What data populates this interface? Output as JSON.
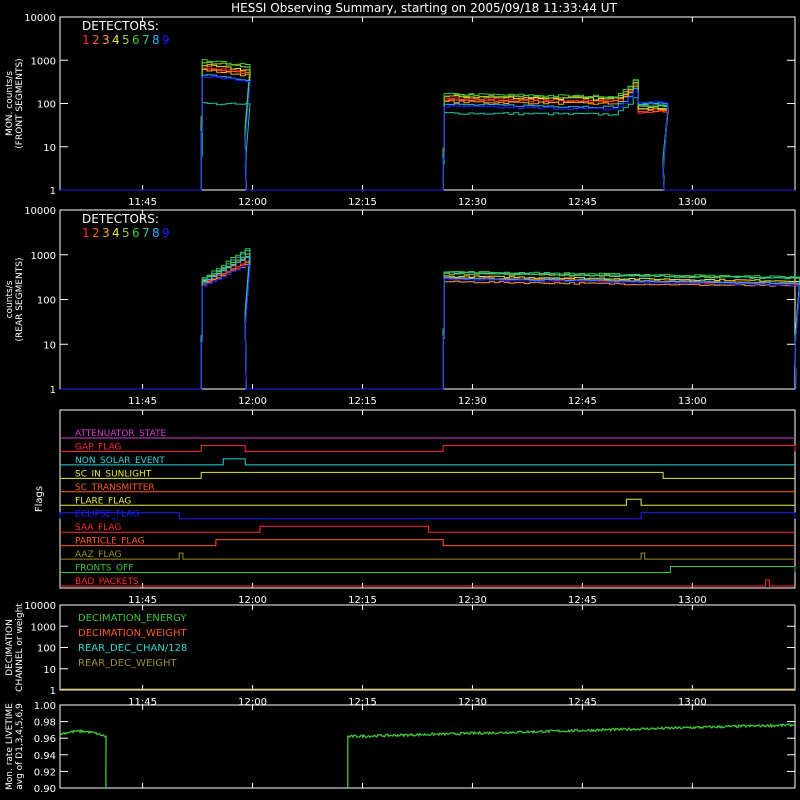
{
  "title": "HESSI Observing Summary, starting on 2005/09/18 11:33:44 UT",
  "colors": {
    "background": "#000000",
    "axes": "#ffffff",
    "detectors": [
      "#ff2a2a",
      "#ff5a1e",
      "#ffa028",
      "#e8e83a",
      "#a4c832",
      "#3cc83c",
      "#1ec8a0",
      "#28b4ff",
      "#1e1eff"
    ]
  },
  "x_ticks": [
    "11:45",
    "12:00",
    "12:15",
    "12:30",
    "12:45",
    "13:00"
  ],
  "chart_data": [
    {
      "type": "line",
      "name": "front",
      "ylabel": [
        "MON. counts/s",
        "(FRONT SEGMENTS)"
      ],
      "yscale": "log",
      "ylim": [
        1,
        10000
      ],
      "y_ticks": [
        "1",
        "10",
        "100",
        "1000",
        "10000"
      ],
      "legend_title": "DETECTORS:",
      "legend_labels": [
        "1",
        "2",
        "3",
        "4",
        "5",
        "6",
        "7",
        "8",
        "9"
      ],
      "segments": [
        {
          "start": "11:53",
          "end": "11:59",
          "start_levels": [
            700,
            650,
            600,
            760,
            900,
            980,
            520,
            480,
            430
          ],
          "end_levels": [
            520,
            500,
            450,
            600,
            700,
            780,
            400,
            360,
            330
          ],
          "outlier_series": 6,
          "outlier_start": 100,
          "outlier_end": 95
        },
        {
          "start": "12:26",
          "end": "12:56",
          "start_levels": [
            130,
            120,
            110,
            145,
            155,
            165,
            60,
            95,
            85
          ],
          "end_levels": [
            110,
            105,
            95,
            120,
            130,
            140,
            55,
            80,
            70
          ],
          "bump_at": "12:52",
          "bump_peak": 380,
          "tail_level": 90
        }
      ]
    },
    {
      "type": "line",
      "name": "rear",
      "ylabel": [
        "counts/s",
        "(REAR SEGMENTS)"
      ],
      "yscale": "log",
      "ylim": [
        1,
        10000
      ],
      "y_ticks": [
        "1",
        "10",
        "100",
        "1000",
        "10000"
      ],
      "legend_title": "DETECTORS:",
      "legend_labels": [
        "1",
        "2",
        "3",
        "4",
        "5",
        "6",
        "7",
        "8",
        "9"
      ],
      "segments": [
        {
          "start": "11:53",
          "end": "11:59",
          "start_levels": [
            230,
            220,
            210,
            250,
            270,
            300,
            280,
            240,
            200
          ],
          "end_levels": [
            700,
            650,
            600,
            900,
            1000,
            1400,
            1200,
            900,
            600
          ]
        },
        {
          "start": "12:26",
          "end": "13:14",
          "start_levels": [
            300,
            310,
            250,
            330,
            380,
            420,
            400,
            300,
            280
          ],
          "end_levels": [
            220,
            230,
            200,
            260,
            300,
            320,
            300,
            230,
            210
          ]
        }
      ]
    },
    {
      "type": "flags",
      "ylabel": "Flags",
      "flags": [
        {
          "label": "ATTENUATOR_STATE",
          "color": "#d040d0",
          "on": []
        },
        {
          "label": "GAP_FLAG",
          "color": "#ff2a2a",
          "on": [
            [
              "11:53",
              "11:59"
            ],
            [
              "12:26",
              "13:14"
            ]
          ]
        },
        {
          "label": "NON_SOLAR_EVENT",
          "color": "#28d8d8",
          "on": [
            [
              "11:56",
              "11:59"
            ]
          ]
        },
        {
          "label": "SC_IN_SUNLIGHT",
          "color": "#e8e83a",
          "on": [
            [
              "11:53",
              "12:56"
            ]
          ]
        },
        {
          "label": "SC_TRANSMITTER",
          "color": "#ff5a1e",
          "on": []
        },
        {
          "label": "FLARE_FLAG",
          "color": "#e8e83a",
          "on": [
            [
              "12:51",
              "12:53"
            ]
          ]
        },
        {
          "label": "ECLIPSE_FLAG",
          "color": "#1e1eff",
          "on": [
            [
              "11:33:44",
              "11:50"
            ],
            [
              "12:53",
              "13:14"
            ]
          ]
        },
        {
          "label": "SAA_FLAG",
          "color": "#ff2a2a",
          "on": [
            [
              "12:01",
              "12:24"
            ]
          ]
        },
        {
          "label": "PARTICLE_FLAG",
          "color": "#ff5a1e",
          "on": [
            [
              "11:55",
              "12:26"
            ]
          ]
        },
        {
          "label": "AAZ_FLAG",
          "color": "#a08c28",
          "on": [
            [
              "11:50",
              "11:50:30"
            ],
            [
              "12:53",
              "12:53:30"
            ]
          ]
        },
        {
          "label": "FRONTS_OFF",
          "color": "#3cc83c",
          "on": [
            [
              "12:57",
              "13:14"
            ]
          ]
        },
        {
          "label": "BAD_PACKETS",
          "color": "#ff2a2a",
          "on": [
            [
              "13:10",
              "13:10:30"
            ]
          ]
        }
      ]
    },
    {
      "type": "line",
      "name": "decimation",
      "ylabel": [
        "DECIMATION",
        "CHANNEL or weight"
      ],
      "yscale": "log",
      "ylim": [
        1,
        10000
      ],
      "y_ticks": [
        "1",
        "10",
        "100",
        "1000",
        "10000"
      ],
      "series": [
        {
          "name": "DECIMATION_ENERGY",
          "color": "#3cc83c"
        },
        {
          "name": "DECIMATION_WEIGHT",
          "color": "#ff5a1e"
        },
        {
          "name": "REAR_DEC_CHAN/128",
          "color": "#28d8d8"
        },
        {
          "name": "REAR_DEC_WEIGHT",
          "color": "#a08c28"
        }
      ],
      "line_value": 1
    },
    {
      "type": "line",
      "name": "livetime",
      "ylabel": [
        "Mon. rate LIVETIME",
        "avg of D1,3,4,5,6,9"
      ],
      "ylim": [
        0.9,
        1.0
      ],
      "y_ticks": [
        "0.90",
        "0.92",
        "0.94",
        "0.96",
        "0.98",
        "1.00"
      ],
      "color": "#3cc83c",
      "segments": [
        {
          "start": "11:33:44",
          "end": "11:40",
          "y_start": 0.965,
          "y_end": 0.962,
          "peak": 0.971
        },
        {
          "start": "12:13",
          "end": "13:14",
          "y_start": 0.962,
          "y_end": 0.976
        }
      ]
    }
  ]
}
